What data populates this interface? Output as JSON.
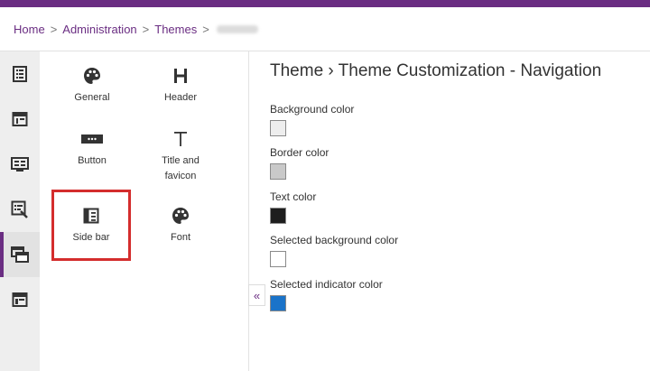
{
  "breadcrumb": {
    "items": [
      "Home",
      "Administration",
      "Themes"
    ],
    "separator": ">"
  },
  "rail": {
    "items": [
      {
        "icon": "list-icon"
      },
      {
        "icon": "layout-icon"
      },
      {
        "icon": "grid-icon"
      },
      {
        "icon": "edit-list-icon"
      },
      {
        "icon": "windows-icon",
        "active": true
      },
      {
        "icon": "browser-icon"
      }
    ]
  },
  "panel": {
    "tiles": [
      {
        "label": "General",
        "icon": "palette-icon"
      },
      {
        "label": "Header",
        "icon": "header-h-icon"
      },
      {
        "label": "Button",
        "icon": "button-icon"
      },
      {
        "label": "Title and favicon",
        "icon": "text-t-icon"
      },
      {
        "label": "Side bar",
        "icon": "sidebar-icon",
        "highlighted": true
      },
      {
        "label": "Font",
        "icon": "palette-icon"
      }
    ],
    "collapse_glyph": "«"
  },
  "content": {
    "title": "Theme › Theme Customization - Navigation",
    "fields": [
      {
        "label": "Background color",
        "color": "#eeeeee"
      },
      {
        "label": "Border color",
        "color": "#c9c9c9"
      },
      {
        "label": "Text color",
        "color": "#1e1e1e"
      },
      {
        "label": "Selected background color",
        "color": "#ffffff"
      },
      {
        "label": "Selected indicator color",
        "color": "#1a73c9"
      }
    ]
  },
  "colors": {
    "brand": "#6a2d82",
    "highlight": "#d42d2d"
  }
}
